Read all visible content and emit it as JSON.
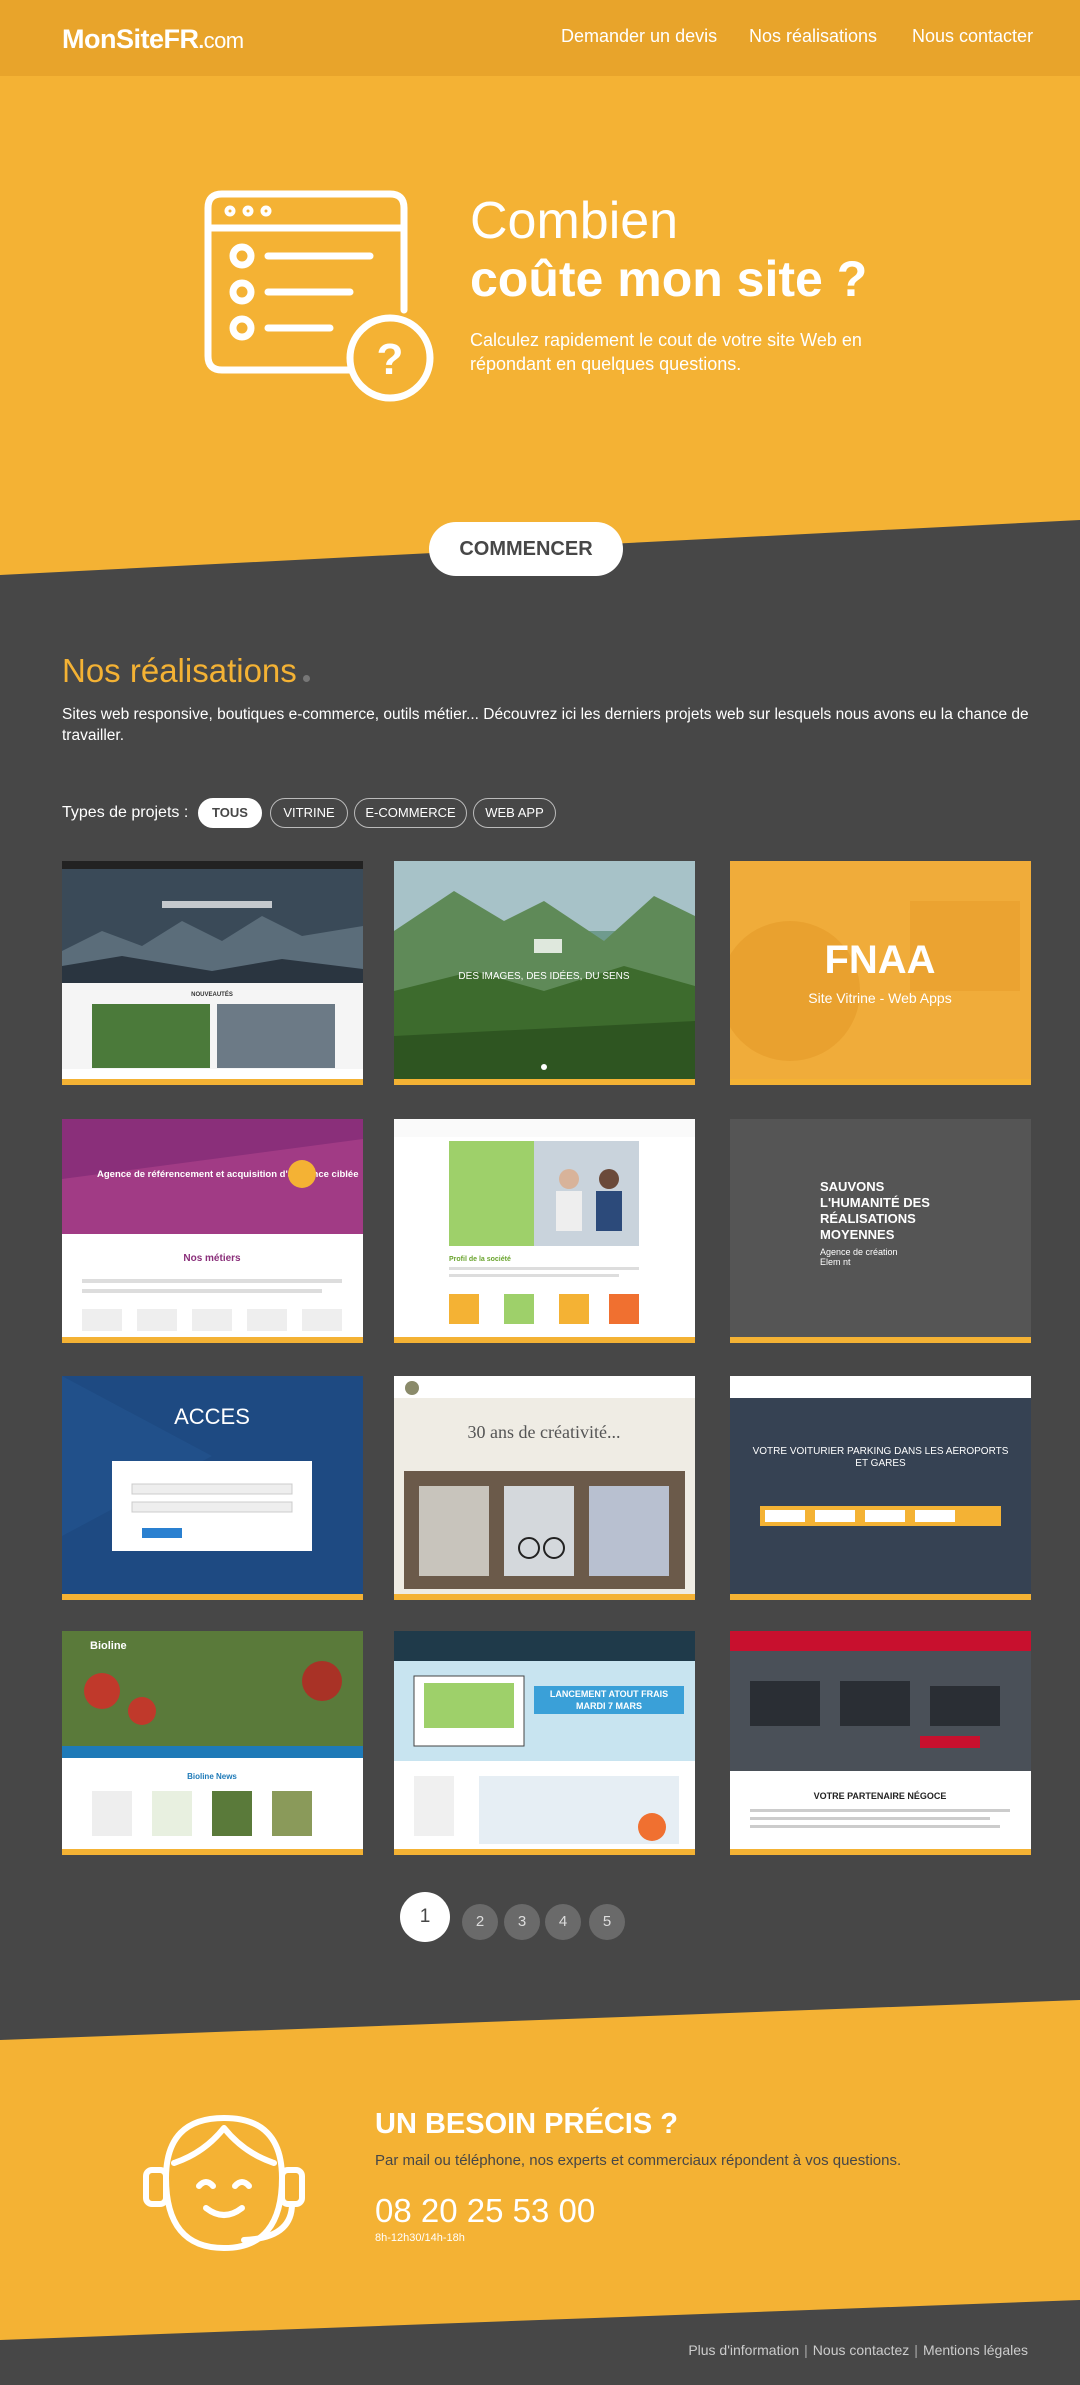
{
  "header": {
    "logo_main": "MonSiteFR",
    "logo_suffix": "com",
    "nav": [
      "Demander un devis",
      "Nos réalisations",
      "Nous contacter"
    ]
  },
  "hero": {
    "title_line1": "Combien",
    "title_line2": "coûte mon site ?",
    "subtitle": "Calculez rapidement le cout de votre site Web en répondant en quelques questions.",
    "cta": "COMMENCER"
  },
  "realisations": {
    "title": "Nos réalisations",
    "description": "Sites web responsive, boutiques e-commerce, outils métier... Découvrez ici les derniers projets web sur lesquels nous avons eu la chance de travailler.",
    "filter_label": "Types de projets :",
    "filters": [
      "TOUS",
      "VITRINE",
      "E-COMMERCE",
      "WEB APP"
    ],
    "active_filter": "TOUS",
    "cards": [
      {
        "id": "card-1",
        "text": "NOUVEAUTÉS"
      },
      {
        "id": "card-2",
        "text": "DES IMAGES, DES IDÉES, DU SENS"
      },
      {
        "id": "card-3",
        "title": "FNAA",
        "subtitle": "Site Vitrine - Web Apps"
      },
      {
        "id": "card-4",
        "heading": "Agence de référencement et acquisition d'audience ciblée",
        "section": "Nos métiers"
      },
      {
        "id": "card-5",
        "heading": "Profil de la société"
      },
      {
        "id": "card-6",
        "heading": "SAUVONS L'HUMANITÉ DES RÉALISATIONS MOYENNES",
        "sub": "Agence de création Elem nt"
      },
      {
        "id": "card-7",
        "heading": "ACCES"
      },
      {
        "id": "card-8",
        "heading": "30 ans de créativité..."
      },
      {
        "id": "card-9",
        "heading": "VOTRE VOITURIER PARKING DANS LES AÉROPORTS ET GARES"
      },
      {
        "id": "card-10",
        "heading": "Bioline",
        "section": "Bioline News"
      },
      {
        "id": "card-11",
        "heading": "LANCEMENT ATOUT FRAIS MARDI 7 MARS"
      },
      {
        "id": "card-12",
        "heading": "VOTRE PARTENAIRE NÉGOCE"
      }
    ],
    "pagination": [
      "1",
      "2",
      "3",
      "4",
      "5"
    ],
    "current_page": "1"
  },
  "contact": {
    "title": "UN BESOIN PRÉCIS ?",
    "subtitle": "Par mail ou téléphone, nos experts et commerciaux répondent à vos questions.",
    "phone": "08 20 25 53 00",
    "hours": "8h-12h30/14h-18h"
  },
  "footer": {
    "links": [
      "Plus d'information",
      "Nous contactez",
      "Mentions légales"
    ]
  },
  "colors": {
    "accent": "#f4b234",
    "dark": "#474747",
    "header": "#e8a42b"
  }
}
